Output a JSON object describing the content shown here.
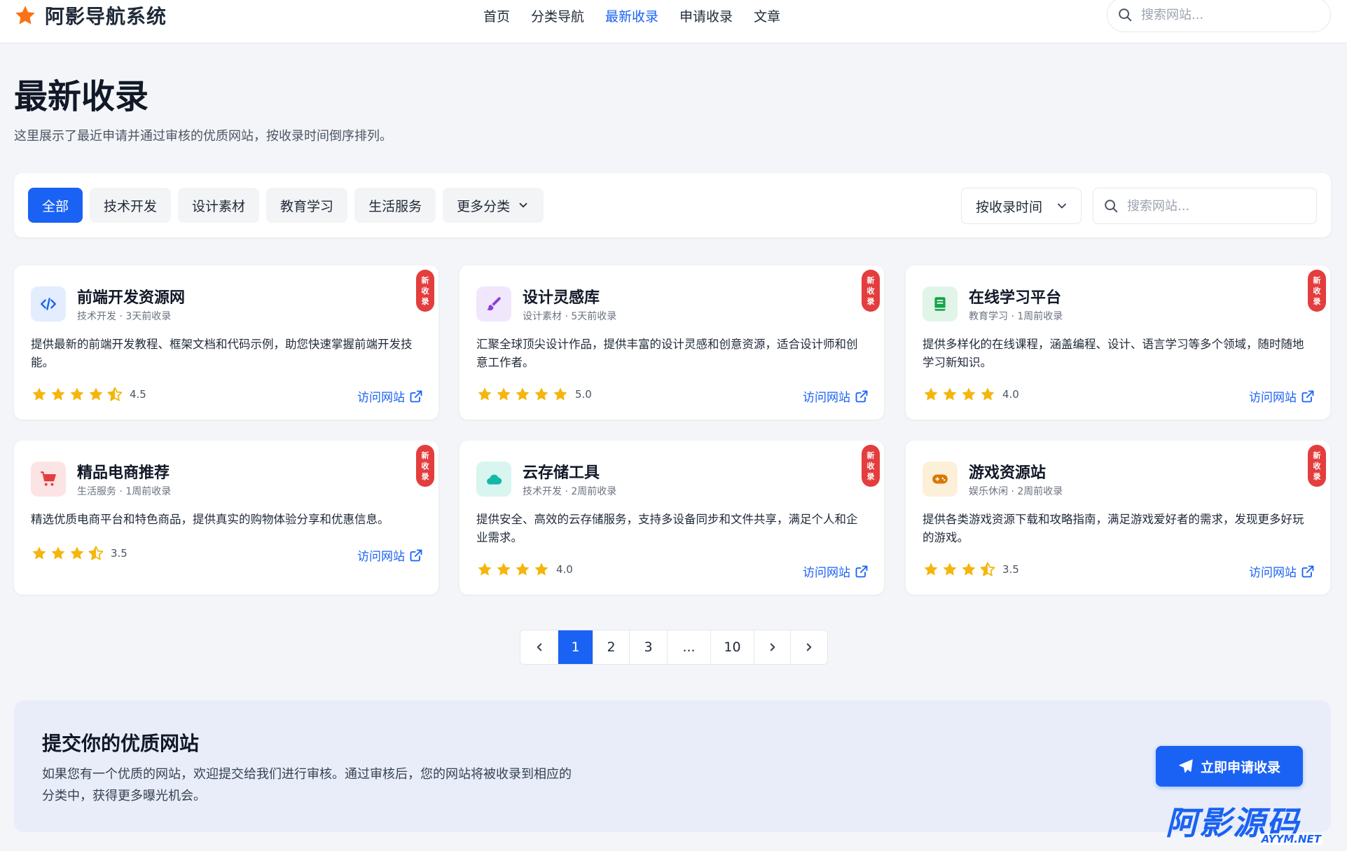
{
  "header": {
    "logo_text": "阿影导航系统",
    "nav": [
      "首页",
      "分类导航",
      "最新收录",
      "申请收录",
      "文章"
    ],
    "active_nav_index": 2,
    "search_placeholder": "搜索网站..."
  },
  "page": {
    "title": "最新收录",
    "description": "这里展示了最近申请并通过审核的优质网站，按收录时间倒序排列。"
  },
  "filter": {
    "categories": [
      "全部",
      "技术开发",
      "设计素材",
      "教育学习",
      "生活服务"
    ],
    "more_label": "更多分类",
    "active_index": 0,
    "sort_label": "按收录时间",
    "search_placeholder": "搜索网站..."
  },
  "colors": {
    "accent": "#1a62f4",
    "badge": "#e43d3d",
    "star": "#f5b50a"
  },
  "cards": [
    {
      "title": "前端开发资源网",
      "meta": "技术开发 · 3天前收录",
      "description": "提供最新的前端开发教程、框架文档和代码示例，助您快速掌握前端开发技能。",
      "rating": 4.5,
      "rating_text": "4.5",
      "icon": "code-icon",
      "icon_bg": "#e3edfd",
      "icon_color": "#1a62f4",
      "badge": [
        "新",
        "收",
        "录"
      ],
      "visit_label": "访问网站"
    },
    {
      "title": "设计灵感库",
      "meta": "设计素材 · 5天前收录",
      "description": "汇聚全球顶尖设计作品，提供丰富的设计灵感和创意资源，适合设计师和创意工作者。",
      "rating": 5.0,
      "rating_text": "5.0",
      "icon": "paint-brush-icon",
      "icon_bg": "#f1e7fc",
      "icon_color": "#8b3fd9",
      "badge": [
        "新",
        "收",
        "录"
      ],
      "visit_label": "访问网站"
    },
    {
      "title": "在线学习平台",
      "meta": "教育学习 · 1周前收录",
      "description": "提供多样化的在线课程，涵盖编程、设计、语言学习等多个领域，随时随地学习新知识。",
      "rating": 4.0,
      "rating_text": "4.0",
      "icon": "book-icon",
      "icon_bg": "#e0f5e7",
      "icon_color": "#16a34a",
      "badge": [
        "新",
        "收",
        "录"
      ],
      "visit_label": "访问网站"
    },
    {
      "title": "精品电商推荐",
      "meta": "生活服务 · 1周前收录",
      "description": "精选优质电商平台和特色商品，提供真实的购物体验分享和优惠信息。",
      "rating": 3.5,
      "rating_text": "3.5",
      "icon": "shopping-cart-icon",
      "icon_bg": "#fde4e4",
      "icon_color": "#e43d3d",
      "badge": [
        "新",
        "收",
        "录"
      ],
      "visit_label": "访问网站"
    },
    {
      "title": "云存储工具",
      "meta": "技术开发 · 2周前收录",
      "description": "提供安全、高效的云存储服务，支持多设备同步和文件共享，满足个人和企业需求。",
      "rating": 4.0,
      "rating_text": "4.0",
      "icon": "cloud-icon",
      "icon_bg": "#d9f5ef",
      "icon_color": "#14b8a6",
      "badge": [
        "新",
        "收",
        "录"
      ],
      "visit_label": "访问网站"
    },
    {
      "title": "游戏资源站",
      "meta": "娱乐休闲 · 2周前收录",
      "description": "提供各类游戏资源下载和攻略指南，满足游戏爱好者的需求，发现更多好玩的游戏。",
      "rating": 3.5,
      "rating_text": "3.5",
      "icon": "gamepad-icon",
      "icon_bg": "#fdf0d9",
      "icon_color": "#d97706",
      "badge": [
        "新",
        "收",
        "录"
      ],
      "visit_label": "访问网站"
    }
  ],
  "pagination": {
    "pages": [
      "1",
      "2",
      "3",
      "...",
      "10"
    ],
    "current": "1"
  },
  "banner": {
    "title": "提交你的优质网站",
    "description": "如果您有一个优质的网站，欢迎提交给我们进行审核。通过审核后，您的网站将被收录到相应的分类中，获得更多曝光机会。",
    "button_label": "立即申请收录"
  },
  "watermark": {
    "cn": "阿影源码",
    "en": "AYYM.NET"
  }
}
